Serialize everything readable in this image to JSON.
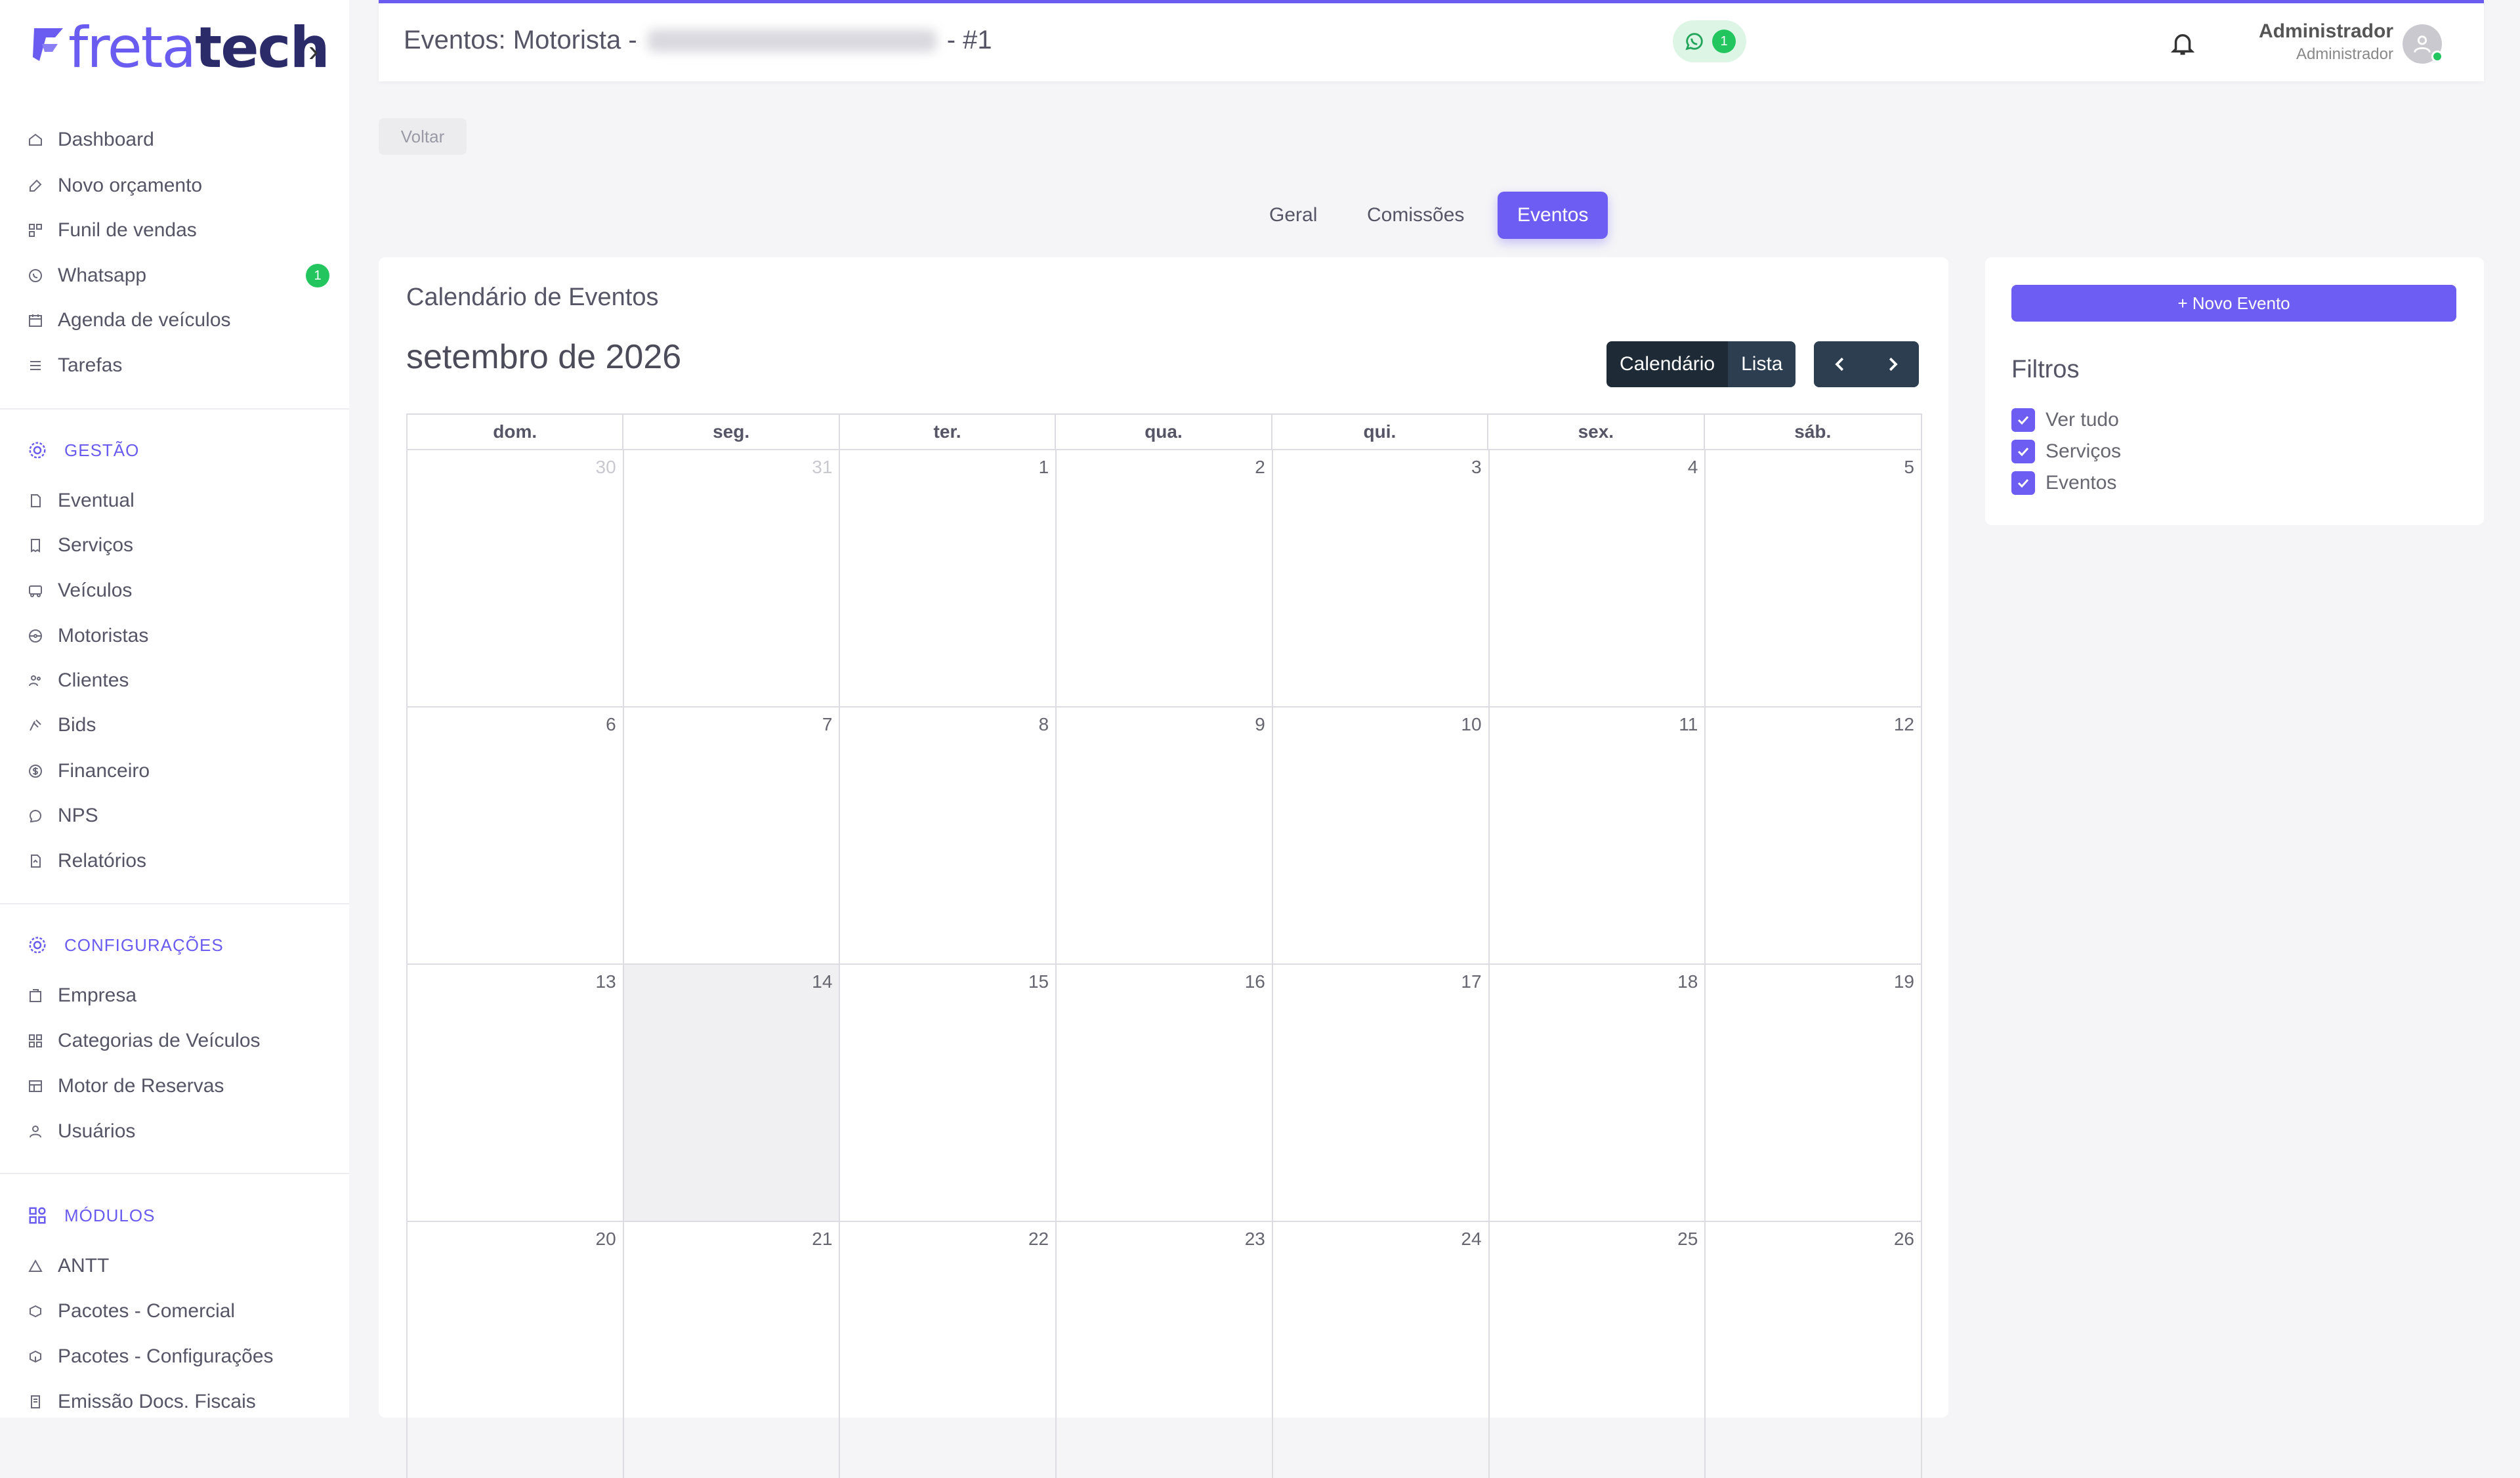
{
  "app": {
    "logo_part1": "freta",
    "logo_part2": "tech"
  },
  "sidebar": {
    "items_main": [
      {
        "label": "Dashboard",
        "icon": "home-icon"
      },
      {
        "label": "Novo orçamento",
        "icon": "edit-icon"
      },
      {
        "label": "Funil de vendas",
        "icon": "funnel-icon"
      },
      {
        "label": "Whatsapp",
        "icon": "whatsapp-icon",
        "badge": "1"
      },
      {
        "label": "Agenda de veículos",
        "icon": "calendar-icon"
      },
      {
        "label": "Tarefas",
        "icon": "list-icon"
      }
    ],
    "section_gestao": "GESTÃO",
    "items_gestao": [
      {
        "label": "Eventual",
        "icon": "document-icon"
      },
      {
        "label": "Serviços",
        "icon": "receipt-icon"
      },
      {
        "label": "Veículos",
        "icon": "bus-icon"
      },
      {
        "label": "Motoristas",
        "icon": "steering-wheel-icon"
      },
      {
        "label": "Clientes",
        "icon": "users-icon"
      },
      {
        "label": "Bids",
        "icon": "gavel-icon"
      },
      {
        "label": "Financeiro",
        "icon": "dollar-icon"
      },
      {
        "label": "NPS",
        "icon": "chat-icon"
      },
      {
        "label": "Relatórios",
        "icon": "report-icon"
      }
    ],
    "section_config": "CONFIGURAÇÕES",
    "items_config": [
      {
        "label": "Empresa",
        "icon": "building-icon"
      },
      {
        "label": "Categorias de Veículos",
        "icon": "grid-icon"
      },
      {
        "label": "Motor de Reservas",
        "icon": "table-icon"
      },
      {
        "label": "Usuários",
        "icon": "user-icon"
      }
    ],
    "section_modulos": "MÓDULOS",
    "items_modulos": [
      {
        "label": "ANTT",
        "icon": "triangle-icon"
      },
      {
        "label": "Pacotes - Comercial",
        "icon": "package-icon"
      },
      {
        "label": "Pacotes - Configurações",
        "icon": "package-settings-icon"
      },
      {
        "label": "Emissão Docs. Fiscais",
        "icon": "fiscal-doc-icon"
      }
    ]
  },
  "header": {
    "title_prefix": "Eventos: Motorista -",
    "title_suffix": "- #1",
    "whatsapp_count": "1",
    "user_name": "Administrador",
    "user_role": "Administrador"
  },
  "back_label": "Voltar",
  "tabs": [
    "Geral",
    "Comissões",
    "Eventos"
  ],
  "active_tab": "Eventos",
  "calendar": {
    "card_title": "Calendário de Eventos",
    "month_label": "setembro de 2026",
    "view_calendar": "Calendário",
    "view_list": "Lista",
    "weekdays": [
      "dom.",
      "seg.",
      "ter.",
      "qua.",
      "qui.",
      "sex.",
      "sáb."
    ],
    "weeks": [
      [
        "30",
        "31",
        "1",
        "2",
        "3",
        "4",
        "5"
      ],
      [
        "6",
        "7",
        "8",
        "9",
        "10",
        "11",
        "12"
      ],
      [
        "13",
        "14",
        "15",
        "16",
        "17",
        "18",
        "19"
      ],
      [
        "20",
        "21",
        "22",
        "23",
        "24",
        "25",
        "26"
      ]
    ],
    "today": "14"
  },
  "filters": {
    "new_event_label": "+ Novo Evento",
    "title": "Filtros",
    "options": [
      "Ver tudo",
      "Serviços",
      "Eventos"
    ]
  },
  "colors": {
    "accent": "#6e5df3",
    "success": "#22c55e",
    "dark_button": "#2c3e50"
  }
}
